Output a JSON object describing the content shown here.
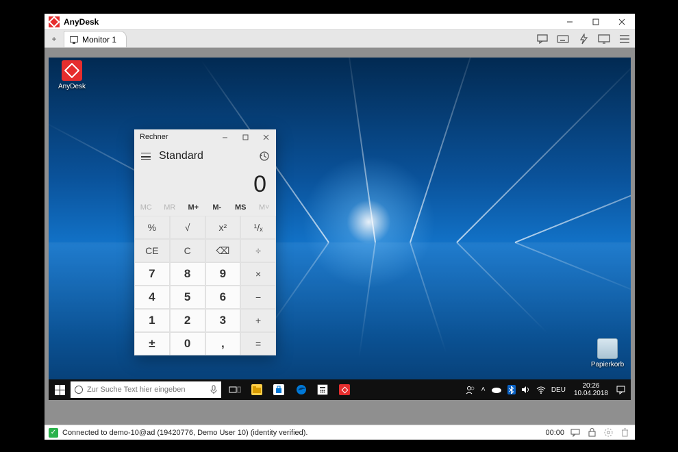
{
  "anydesk": {
    "title": "AnyDesk",
    "tab_label": "Monitor 1",
    "status_text": "Connected to demo-10@ad (19420776, Demo User 10) (identity verified).",
    "session_timer": "00:00"
  },
  "desktop": {
    "icons": {
      "anydesk": "AnyDesk",
      "recycle": "Papierkorb"
    }
  },
  "calculator": {
    "window_title": "Rechner",
    "mode": "Standard",
    "display": "0",
    "memory": [
      "MC",
      "MR",
      "M+",
      "M-",
      "MS",
      "M˅"
    ],
    "keys_fn1": [
      "%",
      "√",
      "x²",
      "¹/ₓ"
    ],
    "keys_fn2": [
      "CE",
      "C",
      "⌫",
      "÷"
    ],
    "rows": [
      [
        "7",
        "8",
        "9",
        "×"
      ],
      [
        "4",
        "5",
        "6",
        "−"
      ],
      [
        "1",
        "2",
        "3",
        "+"
      ],
      [
        "±",
        "0",
        ",",
        "="
      ]
    ]
  },
  "taskbar": {
    "search_placeholder": "Zur Suche Text hier eingeben",
    "lang": "DEU",
    "time": "20:26",
    "date": "10.04.2018"
  }
}
